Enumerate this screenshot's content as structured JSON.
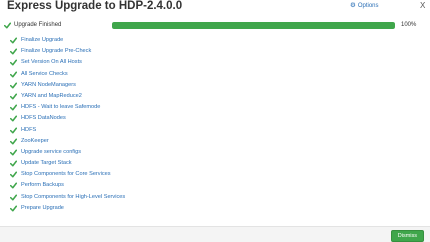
{
  "dialog": {
    "title": "Express Upgrade to HDP-2.4.0.0",
    "options_label": "Options",
    "close_glyph": "X"
  },
  "status": {
    "label": "Upgrade Finished",
    "progress_fraction": 1.0,
    "percent_text": "100%",
    "color": "#3fa64b"
  },
  "tasks": [
    "Finalize Upgrade",
    "Finalize Upgrade Pre-Check",
    "Set Version On All Hosts",
    "All Service Checks",
    "YARN NodeManagers",
    "YARN and MapReduce2",
    "HDFS - Wait to leave Safemode",
    "HDFS DataNodes",
    "HDFS",
    "ZooKeeper",
    "Upgrade service configs",
    "Update Target Stack",
    "Stop Components for Core Services",
    "Perform Backups",
    "Stop Components for High-Level Services",
    "Prepare Upgrade"
  ],
  "footer": {
    "dismiss_label": "Dismiss"
  },
  "colors": {
    "accent": "#3fa64b",
    "link": "#2a6fb6"
  }
}
